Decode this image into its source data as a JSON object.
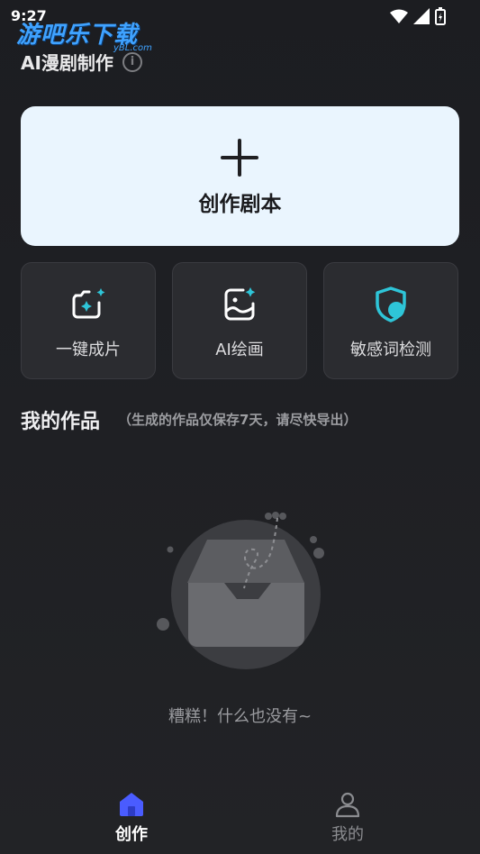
{
  "status_bar": {
    "time": "9:27"
  },
  "watermark": {
    "title": "游吧乐下载",
    "sub": "yBL.com"
  },
  "header": {
    "title": "AI漫剧制作"
  },
  "create_card": {
    "label": "创作剧本"
  },
  "tools": [
    {
      "label": "一键成片",
      "icon": "camera-sparkle-icon"
    },
    {
      "label": "AI绘画",
      "icon": "image-sparkle-icon"
    },
    {
      "label": "敏感词检测",
      "icon": "shield-icon"
    }
  ],
  "works": {
    "title": "我的作品",
    "note": "（生成的作品仅保存7天，请尽快导出）",
    "empty_text": "糟糕！什么也没有~"
  },
  "tabbar": {
    "tabs": [
      {
        "label": "创作",
        "icon": "home-icon",
        "active": true
      },
      {
        "label": "我的",
        "icon": "user-icon",
        "active": false
      }
    ]
  },
  "colors": {
    "accent": "#4a5cff",
    "card_bg": "#eaf5fe",
    "tool_accent": "#2ec5d8"
  }
}
